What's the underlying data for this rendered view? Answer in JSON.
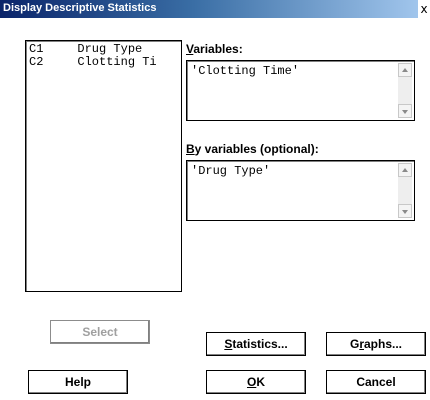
{
  "window": {
    "title": "Display Descriptive Statistics",
    "close_glyph": "x"
  },
  "variables_list": [
    {
      "col": "C1",
      "name": "Drug Type"
    },
    {
      "col": "C2",
      "name": "Clotting Ti"
    }
  ],
  "variables": {
    "label_first": "V",
    "label_rest": "ariables:",
    "value": "'Clotting Time'"
  },
  "by_variables": {
    "label_first": "B",
    "label_rest": "y variables (optional):",
    "value": "'Drug Type'"
  },
  "buttons": {
    "select": "Select",
    "statistics": {
      "first": "S",
      "rest": "tatistics..."
    },
    "graphs": {
      "pre": "G",
      "under": "r",
      "post": "aphs..."
    },
    "help": "Help",
    "ok": {
      "first": "O",
      "rest": "K"
    },
    "cancel": "Cancel"
  }
}
